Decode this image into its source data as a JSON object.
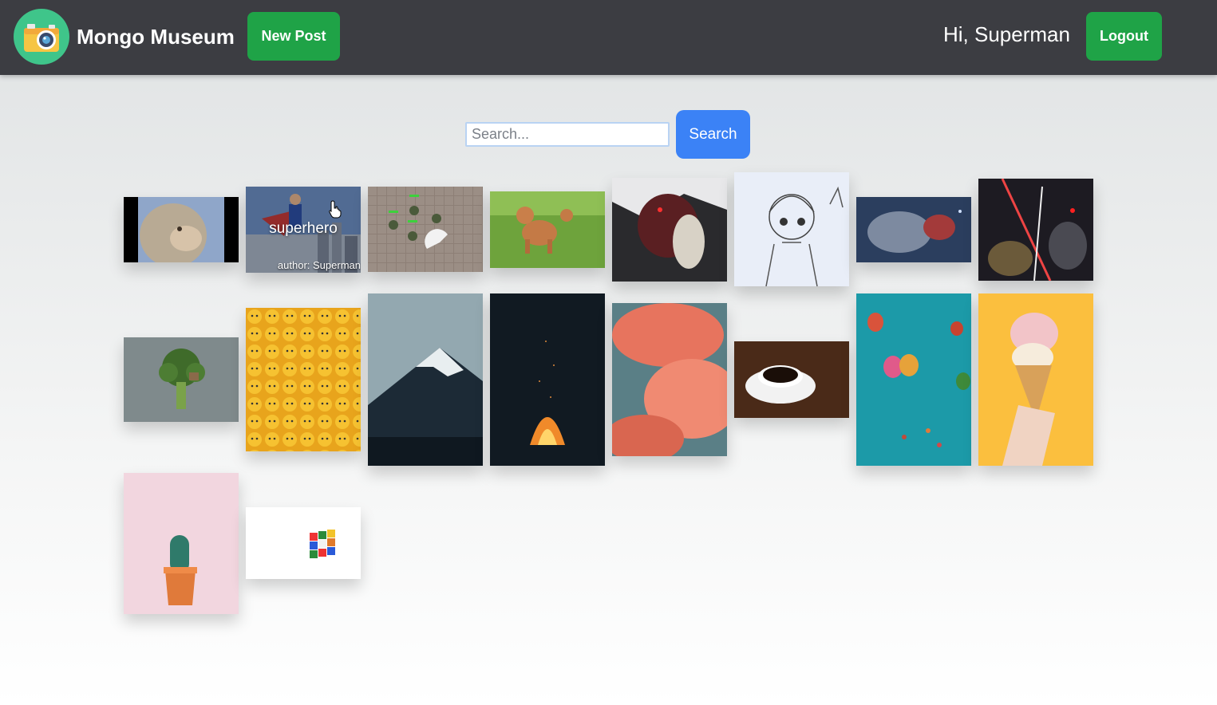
{
  "header": {
    "brand": "Mongo Museum",
    "new_post_label": "New Post",
    "greeting": "Hi, Superman",
    "logout_label": "Logout"
  },
  "search": {
    "placeholder": "Search...",
    "value": "",
    "button_label": "Search"
  },
  "gallery": {
    "hovered_tile": {
      "title": "superhero",
      "author": "author: Superman"
    }
  },
  "colors": {
    "navbar": "#3c3d42",
    "accent_green": "#1fa347",
    "search_blue": "#3b82f6",
    "logo_bg": "#3fc58a"
  }
}
